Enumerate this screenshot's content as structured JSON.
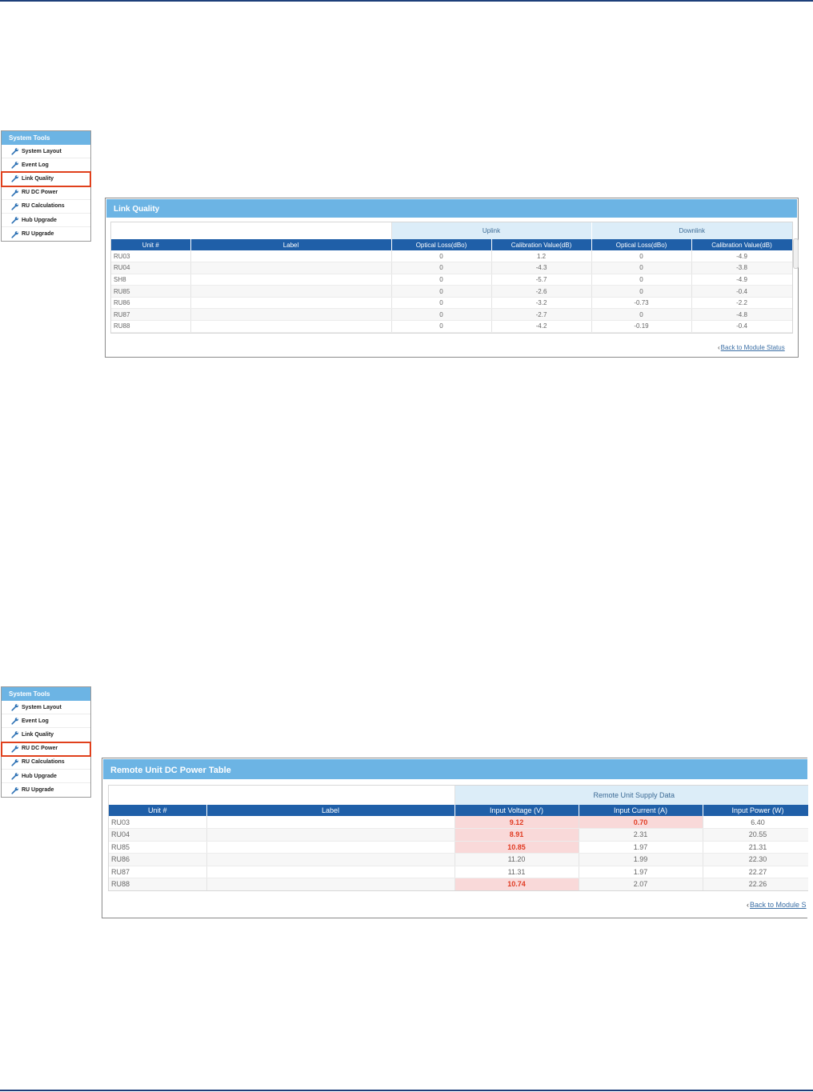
{
  "sidebar_top": {
    "title": "System Tools",
    "items": [
      {
        "label": "System Layout"
      },
      {
        "label": "Event Log"
      },
      {
        "label": "Link Quality"
      },
      {
        "label": "RU DC Power"
      },
      {
        "label": "RU Calculations"
      },
      {
        "label": "Hub Upgrade"
      },
      {
        "label": "RU Upgrade"
      }
    ],
    "selected": "Link Quality"
  },
  "link_quality": {
    "title": "Link Quality",
    "group_uplink": "Uplink",
    "group_downlink": "Downlink",
    "columns": [
      "Unit #",
      "Label",
      "Optical Loss(dBo)",
      "Calibration Value(dB)",
      "Optical Loss(dBo)",
      "Calibration Value(dB)"
    ],
    "rows": [
      [
        "RU03",
        "",
        "0",
        "1.2",
        "0",
        "-4.9"
      ],
      [
        "RU04",
        "",
        "0",
        "-4.3",
        "0",
        "-3.8"
      ],
      [
        "SH8",
        "",
        "0",
        "-5.7",
        "0",
        "-4.9"
      ],
      [
        "RU85",
        "",
        "0",
        "-2.6",
        "0",
        "-0.4"
      ],
      [
        "RU86",
        "",
        "0",
        "-3.2",
        "-0.73",
        "-2.2"
      ],
      [
        "RU87",
        "",
        "0",
        "-2.7",
        "0",
        "-4.8"
      ],
      [
        "RU88",
        "",
        "0",
        "-4.2",
        "-0.19",
        "-0.4"
      ]
    ],
    "back_link": "Back to Module Status"
  },
  "sidebar_bottom": {
    "title": "System Tools",
    "items": [
      {
        "label": "System Layout"
      },
      {
        "label": "Event Log"
      },
      {
        "label": "Link Quality"
      },
      {
        "label": "RU DC Power"
      },
      {
        "label": "RU Calculations"
      },
      {
        "label": "Hub Upgrade"
      },
      {
        "label": "RU Upgrade"
      }
    ],
    "selected": "RU DC Power"
  },
  "dc_power": {
    "title": "Remote Unit DC Power Table",
    "group_label": "Remote Unit Supply Data",
    "columns": [
      "Unit #",
      "Label",
      "Input Voltage (V)",
      "Input Current (A)",
      "Input Power (W)"
    ],
    "rows": [
      {
        "cells": [
          "RU03",
          "",
          "9.12",
          "0.70",
          "6.40"
        ],
        "alerts": [
          2,
          3
        ]
      },
      {
        "cells": [
          "RU04",
          "",
          "8.91",
          "2.31",
          "20.55"
        ],
        "alerts": [
          2
        ]
      },
      {
        "cells": [
          "RU85",
          "",
          "10.85",
          "1.97",
          "21.31"
        ],
        "alerts": [
          2
        ]
      },
      {
        "cells": [
          "RU86",
          "",
          "11.20",
          "1.99",
          "22.30"
        ],
        "alerts": []
      },
      {
        "cells": [
          "RU87",
          "",
          "11.31",
          "1.97",
          "22.27"
        ],
        "alerts": []
      },
      {
        "cells": [
          "RU88",
          "",
          "10.74",
          "2.07",
          "22.26"
        ],
        "alerts": [
          2
        ]
      }
    ],
    "back_link": "Back to Module S"
  },
  "colors": {
    "header_blue": "#6cb4e4",
    "column_blue": "#1f5fa8",
    "group_bg": "#dcedf8",
    "selection_red": "#e0401c",
    "alert_bg": "#f9d9d9",
    "alert_text": "#e03b22"
  },
  "icons": {
    "menu_item": "wrench-icon",
    "back": "chevron-left-icon"
  }
}
